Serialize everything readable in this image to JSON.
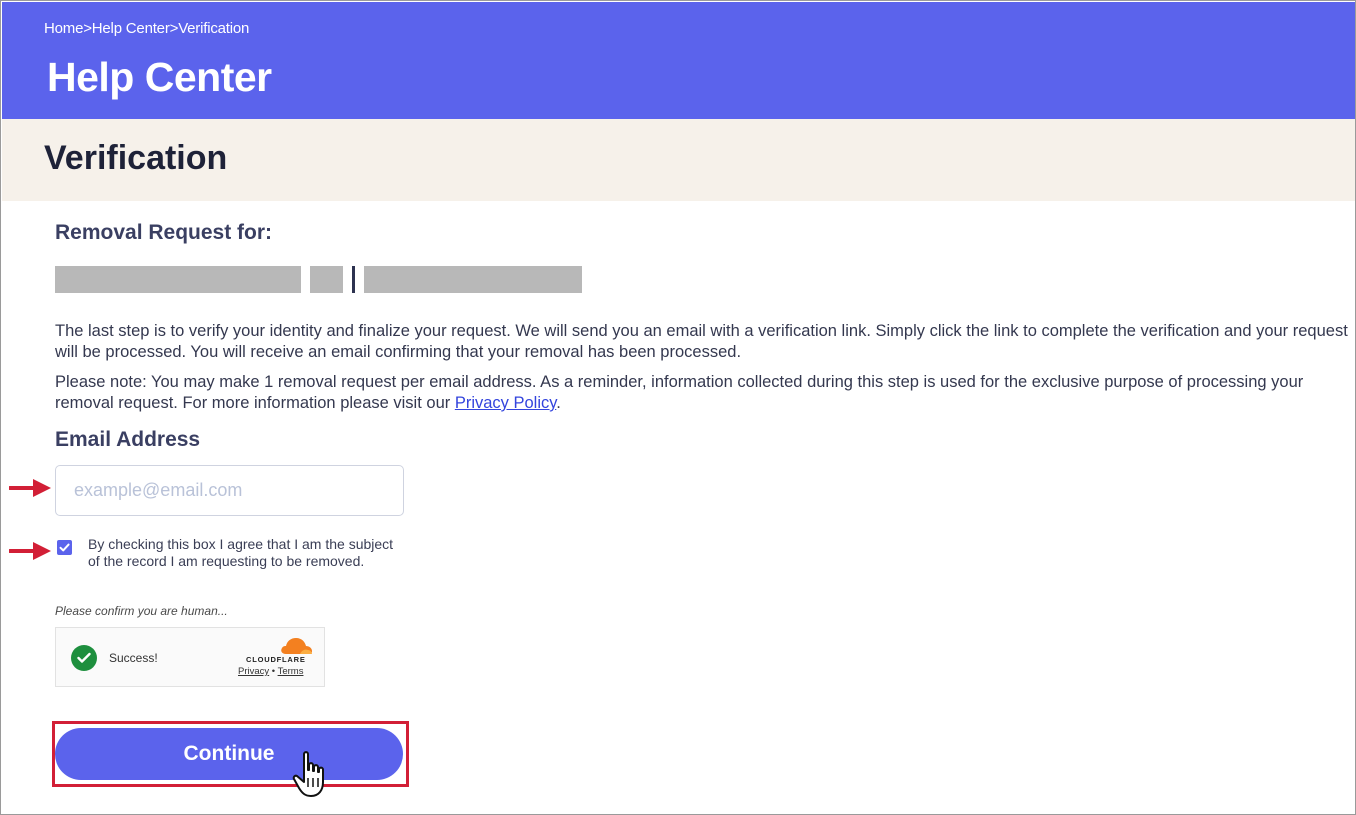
{
  "header": {
    "breadcrumb": [
      "Home",
      ">",
      "Help Center",
      ">",
      "Verification"
    ],
    "title": "Help Center"
  },
  "subheader": {
    "title": "Verification"
  },
  "request": {
    "label": "Removal Request for:"
  },
  "body": {
    "para1": "The last step is to verify your identity and finalize your request. We will send you an email with a verification link. Simply click the link to complete the verification and your request will be processed. You will receive an email confirming that your removal has been processed.",
    "para2_prefix": "Please note: You may make 1 removal request per email address. As a reminder, information collected during this step is used for the exclusive purpose of processing your removal request. For more information please visit our ",
    "privacy_link": "Privacy Policy",
    "para2_suffix": "."
  },
  "form": {
    "email_label": "Email Address",
    "email_placeholder": "example@email.com",
    "email_value": "",
    "checkbox_checked": true,
    "checkbox_label": "By checking this box I agree that I am the subject of the record I am requesting to be removed.",
    "human_note": "Please confirm you are human...",
    "captcha": {
      "status": "Success!",
      "brand": "CLOUDFLARE",
      "privacy": "Privacy",
      "separator": "•",
      "terms": "Terms"
    },
    "continue_label": "Continue"
  },
  "colors": {
    "brand": "#5b63ec",
    "subheader_bg": "#f6f1ea",
    "annotation_red": "#d21f36",
    "success_green": "#1e8f3e"
  },
  "icons": [
    "check-icon",
    "success-check-icon",
    "cloudflare-logo-icon",
    "pointer-hand-icon",
    "annotation-arrow-icon"
  ]
}
